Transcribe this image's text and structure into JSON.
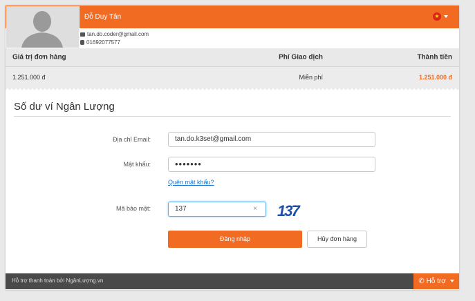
{
  "header": {
    "user_name": "Đỗ Duy Tân",
    "email": "tan.do.coder@gmail.com",
    "phone": "01692077577",
    "flag_icon": "vietnam-flag-icon"
  },
  "order_table": {
    "col_order_value": "Giá trị đơn hàng",
    "col_fee": "Phí Giao dịch",
    "col_total": "Thành tiền",
    "order_value": "1.251.000 đ",
    "fee": "Miễn phí",
    "total": "1.251.000 đ"
  },
  "form": {
    "title": "Số dư ví Ngân Lượng",
    "email_label": "Địa chỉ Email:",
    "email_value": "tan.do.k3set@gmail.com",
    "password_label": "Mật khẩu:",
    "password_value": "•••••••",
    "forgot_link": "Quên mật khẩu?",
    "captcha_label": "Mã bảo mật:",
    "captcha_value": "137",
    "captcha_image_text": "137",
    "clear_icon": "×",
    "login_button": "Đăng nhập",
    "cancel_button": "Hủy đơn hàng"
  },
  "footer": {
    "text": "Hỗ trợ thanh toán bởi NgânLượng.vn",
    "support_button": "Hỗ trợ",
    "support_icon": "phone-icon"
  },
  "colors": {
    "accent": "#f26b23",
    "footer_bg": "#4a4a4a"
  }
}
